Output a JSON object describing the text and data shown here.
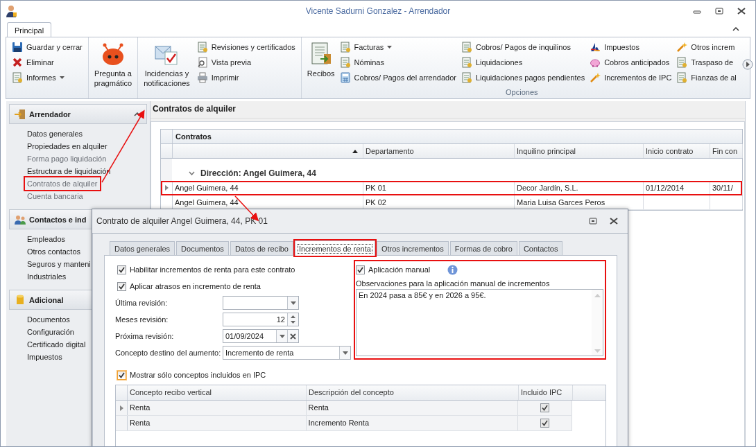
{
  "window": {
    "title": "Vicente Sadurni Gonzalez - Arrendador"
  },
  "ribbon": {
    "tabs": [
      {
        "label": "Principal",
        "selected": true
      }
    ],
    "groups": [
      {
        "columns": [
          {
            "kind": "stack",
            "items": [
              {
                "label": "Guardar y cerrar",
                "dropdown": false
              },
              {
                "label": "Eliminar",
                "dropdown": false
              },
              {
                "label": "Informes",
                "dropdown": true
              }
            ]
          }
        ]
      },
      {
        "columns": [
          {
            "kind": "large",
            "label": "Pregunta a pragmático"
          }
        ]
      },
      {
        "columns": [
          {
            "kind": "large",
            "label": "Incidencias y notificaciones"
          },
          {
            "kind": "stack",
            "items": [
              {
                "label": "Revisiones y certificados",
                "dropdown": false
              },
              {
                "label": "Vista previa",
                "dropdown": false
              },
              {
                "label": "Imprimir",
                "dropdown": false
              }
            ]
          }
        ]
      },
      {
        "label": "Opciones",
        "columns": [
          {
            "kind": "large",
            "label": "Recibos"
          },
          {
            "kind": "stack",
            "items": [
              {
                "label": "Facturas",
                "dropdown": true
              },
              {
                "label": "Nóminas",
                "dropdown": false
              },
              {
                "label": "Cobros/ Pagos del arrendador",
                "dropdown": false
              }
            ]
          },
          {
            "kind": "stack",
            "items": [
              {
                "label": "Cobros/ Pagos de inquilinos",
                "dropdown": false
              },
              {
                "label": "Liquidaciones",
                "dropdown": false
              },
              {
                "label": "Liquidaciones pagos pendientes",
                "dropdown": false
              }
            ]
          },
          {
            "kind": "stack",
            "items": [
              {
                "label": "Impuestos",
                "dropdown": false
              },
              {
                "label": "Cobros anticipados",
                "dropdown": false
              },
              {
                "label": "Incrementos de IPC",
                "dropdown": false
              }
            ]
          },
          {
            "kind": "stack",
            "items": [
              {
                "label": "Otros increm",
                "dropdown": false
              },
              {
                "label": "Traspaso de",
                "dropdown": false
              },
              {
                "label": "Fianzas de al",
                "dropdown": false
              }
            ]
          }
        ]
      }
    ]
  },
  "sidebar": {
    "groups": [
      {
        "title": "Arrendador",
        "expanded": true,
        "items": [
          {
            "label": "Datos generales",
            "disabled": false,
            "highlighted": false
          },
          {
            "label": "Propiedades en alquiler",
            "disabled": false,
            "highlighted": false
          },
          {
            "label": "Forma pago liquidación",
            "disabled": true,
            "highlighted": false
          },
          {
            "label": "Estructura de liquidación",
            "disabled": false,
            "highlighted": false
          },
          {
            "label": "Contratos de alquiler",
            "disabled": true,
            "highlighted": true
          },
          {
            "label": "Cuenta bancaria",
            "disabled": true,
            "highlighted": false
          }
        ]
      },
      {
        "title": "Contactos e ind",
        "items": [
          {
            "label": "Empleados",
            "disabled": false,
            "highlighted": false
          },
          {
            "label": "Otros contactos",
            "disabled": false,
            "highlighted": false
          },
          {
            "label": "Seguros y manteni",
            "disabled": false,
            "highlighted": false
          },
          {
            "label": "Industriales",
            "disabled": false,
            "highlighted": false
          }
        ]
      },
      {
        "title": "Adicional",
        "items": [
          {
            "label": "Documentos",
            "disabled": false,
            "highlighted": false
          },
          {
            "label": "Configuración",
            "disabled": false,
            "highlighted": false
          },
          {
            "label": "Certificado digital",
            "disabled": false,
            "highlighted": false
          },
          {
            "label": "Impuestos",
            "disabled": false,
            "highlighted": false
          }
        ]
      }
    ]
  },
  "content": {
    "title": "Contratos de alquiler",
    "grid": {
      "title": "Contratos",
      "columns": [
        "",
        "Departamento",
        "Inquilino principal",
        "Inicio contrato",
        "Fin con"
      ],
      "group_row": "Dirección: Angel Guimera, 44",
      "rows": [
        {
          "cells": [
            "Angel Guimera, 44",
            "PK 01",
            "Decor Jardín, S.L.",
            "01/12/2014",
            "30/11/"
          ],
          "selected": true,
          "highlighted": true
        },
        {
          "cells": [
            "Angel Guimera, 44",
            "PK 02",
            "Maria Luisa Garces Peros",
            "",
            ""
          ],
          "selected": false,
          "highlighted": false
        }
      ]
    }
  },
  "dialog": {
    "title": "Contrato de alquiler Angel Guimera, 44, PK 01",
    "tabs": [
      {
        "label": "Datos generales",
        "selected": false,
        "highlighted": false
      },
      {
        "label": "Documentos",
        "selected": false,
        "highlighted": false
      },
      {
        "label": "Datos de recibo",
        "selected": false,
        "highlighted": false
      },
      {
        "label": "Incrementos de renta",
        "selected": true,
        "highlighted": true
      },
      {
        "label": "Otros incrementos",
        "selected": false,
        "highlighted": false
      },
      {
        "label": "Formas de cobro",
        "selected": false,
        "highlighted": false
      },
      {
        "label": "Contactos",
        "selected": false,
        "highlighted": false
      }
    ],
    "options": [
      {
        "label": "Habilitar incrementos de renta para este contrato",
        "checked": true
      },
      {
        "label": "Aplicar atrasos en incremento de renta",
        "checked": true
      }
    ],
    "fields": [
      {
        "label": "Última revisión:",
        "kind": "dropdown"
      },
      {
        "label": "Meses revisión:",
        "value": "12",
        "kind": "spinner"
      },
      {
        "label": "Próxima revisión:",
        "value": "01/09/2024",
        "kind": "date"
      },
      {
        "label": "Concepto destino del aumento:",
        "value": "Incremento de renta",
        "kind": "combo"
      }
    ],
    "manual": {
      "label": "Aplicación manual",
      "checked": true,
      "highlighted": true,
      "notes_label": "Observaciones para la aplicación manual de incrementos",
      "notes": "En 2024 pasa a 85€ y en 2026 a 95€."
    },
    "filter": {
      "label": "Mostrar sólo conceptos incluidos en IPC",
      "checked": true
    },
    "grid": {
      "columns": [
        "Concepto recibo vertical",
        "Descripción del concepto",
        "Incluido IPC"
      ],
      "rows": [
        {
          "concept": "Renta",
          "description": "Renta",
          "included": true,
          "selected": true
        },
        {
          "concept": "Renta",
          "description": "Incremento Renta",
          "included": true,
          "selected": false
        }
      ]
    }
  }
}
